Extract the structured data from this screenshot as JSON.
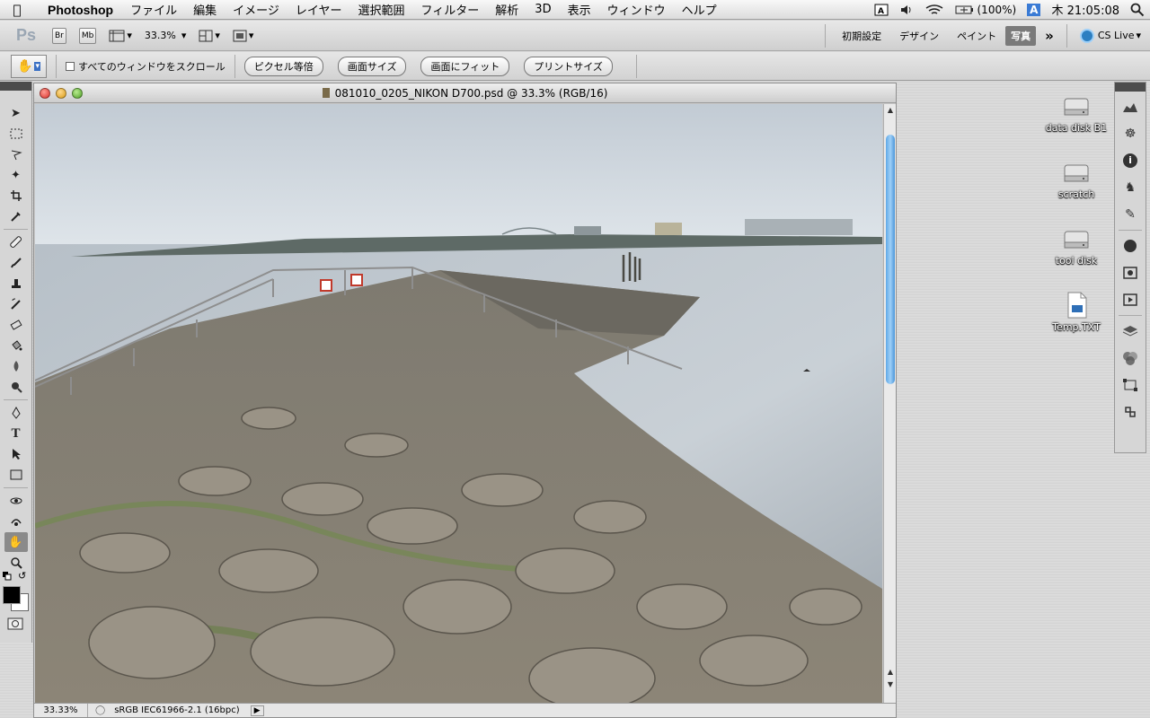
{
  "menubar": {
    "app_name": "Photoshop",
    "items": [
      "ファイル",
      "編集",
      "イメージ",
      "レイヤー",
      "選択範囲",
      "フィルター",
      "解析",
      "3D",
      "表示",
      "ウィンドウ",
      "ヘルプ"
    ],
    "status": {
      "battery": "(100%)",
      "input_method": "A",
      "clock": "木 21:05:08"
    }
  },
  "appbar": {
    "logo": "Ps",
    "br_label": "Br",
    "mb_label": "Mb",
    "zoom": "33.3%",
    "workspaces": [
      "初期設定",
      "デザイン",
      "ペイント",
      "写真"
    ],
    "selected_workspace": "写真",
    "cs_live": "CS Live"
  },
  "options": {
    "scroll_all_label": "すべてのウィンドウをスクロール",
    "buttons": [
      "ピクセル等倍",
      "画面サイズ",
      "画面にフィット",
      "プリントサイズ"
    ]
  },
  "document": {
    "title": "081010_0205_NIKON D700.psd @ 33.3% (RGB/16)",
    "status_zoom": "33.33%",
    "status_profile": "sRGB IEC61966-2.1 (16bpc)",
    "scroll_fraction": 0.42
  },
  "desktop": {
    "icons": [
      {
        "label": "data disk B1",
        "kind": "disk"
      },
      {
        "label": "scratch",
        "kind": "disk"
      },
      {
        "label": "tool disk",
        "kind": "disk"
      },
      {
        "label": "Temp.TXT",
        "kind": "text-file"
      }
    ]
  },
  "colors": {
    "foreground": "#000000",
    "background": "#ffffff",
    "selected_workspace_bg": "#7a7a7a"
  }
}
